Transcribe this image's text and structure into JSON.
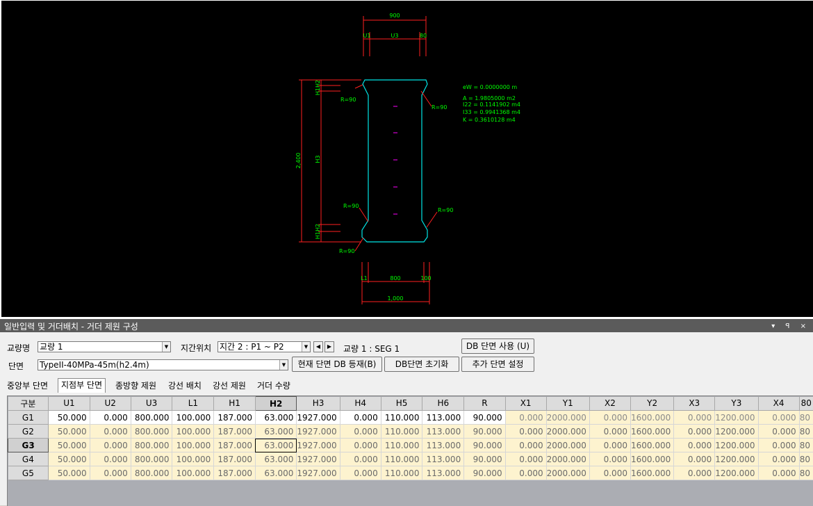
{
  "drawing": {
    "top_dims": {
      "total": "900",
      "u1": "U1",
      "u3": "U3",
      "u_right": "80"
    },
    "bottom_dims": {
      "l1": "L1",
      "mid": "800",
      "right": "100",
      "total": "1,000"
    },
    "height_total": "2,400",
    "h_labels": {
      "top": "H1H2",
      "mid": "H3",
      "bottom": "H1H2"
    },
    "radius_labels": [
      "R=90",
      "R=90",
      "R=90",
      "R=90",
      "R=90"
    ],
    "props": [
      "eW  = 0.0000000 m",
      "A   = 1.9805000 m2",
      "I22 = 0.1141902 m4",
      "I33 = 0.9941368 m4",
      "K   = 0.3610128 m4"
    ],
    "colors": {
      "outline": "#00e5e5",
      "dim": "#ff2020",
      "text": "#00ff00",
      "mark": "#ff00ff"
    }
  },
  "panel": {
    "title": "일반입력 및 거더배치 - 거더 제원 구성",
    "title_controls": "▾ ꟼ ×",
    "bridge_label": "교량명",
    "bridge_value": "교량 1",
    "span_label": "지간위치",
    "span_value": "지간 2 : P1 ~ P2",
    "seg_text": "교량 1 : SEG 1",
    "section_label": "단면",
    "section_value": "TypeII-40MPa-45m(h2.4m)",
    "buttons": {
      "db_use": "DB 단면 사용 (U)",
      "register": "현재 단면 DB 등재(B)",
      "reset": "DB단면 초기화",
      "add_section": "추가 단면 설정"
    },
    "tabs": [
      "중앙부 단면",
      "지점부 단면",
      "종방향 제원",
      "강선 배치",
      "강선 제원",
      "거더 수량"
    ],
    "active_tab": "지점부 단면"
  },
  "grid": {
    "columns": [
      "구분",
      "U1",
      "U2",
      "U3",
      "L1",
      "H1",
      "H2",
      "H3",
      "H4",
      "H5",
      "H6",
      "R",
      "X1",
      "Y1",
      "X2",
      "Y2",
      "X3",
      "Y3",
      "X4",
      "80"
    ],
    "selected_column": "H2",
    "selected_row": "G3",
    "rows": [
      {
        "name": "G1",
        "values": [
          "50.000",
          "0.000",
          "800.000",
          "100.000",
          "187.000",
          "63.000",
          "1927.000",
          "0.000",
          "110.000",
          "113.000",
          "90.000",
          "0.000",
          "2000.000",
          "0.000",
          "1600.000",
          "0.000",
          "1200.000",
          "0.000",
          "80"
        ]
      },
      {
        "name": "G2",
        "values": [
          "50.000",
          "0.000",
          "800.000",
          "100.000",
          "187.000",
          "63.000",
          "1927.000",
          "0.000",
          "110.000",
          "113.000",
          "90.000",
          "0.000",
          "2000.000",
          "0.000",
          "1600.000",
          "0.000",
          "1200.000",
          "0.000",
          "80"
        ]
      },
      {
        "name": "G3",
        "values": [
          "50.000",
          "0.000",
          "800.000",
          "100.000",
          "187.000",
          "63.000",
          "1927.000",
          "0.000",
          "110.000",
          "113.000",
          "90.000",
          "0.000",
          "2000.000",
          "0.000",
          "1600.000",
          "0.000",
          "1200.000",
          "0.000",
          "80"
        ]
      },
      {
        "name": "G4",
        "values": [
          "50.000",
          "0.000",
          "800.000",
          "100.000",
          "187.000",
          "63.000",
          "1927.000",
          "0.000",
          "110.000",
          "113.000",
          "90.000",
          "0.000",
          "2000.000",
          "0.000",
          "1600.000",
          "0.000",
          "1200.000",
          "0.000",
          "80"
        ]
      },
      {
        "name": "G5",
        "values": [
          "50.000",
          "0.000",
          "800.000",
          "100.000",
          "187.000",
          "63.000",
          "1927.000",
          "0.000",
          "110.000",
          "113.000",
          "90.000",
          "0.000",
          "2000.000",
          "0.000",
          "1600.000",
          "0.000",
          "1200.000",
          "0.000",
          "80"
        ]
      }
    ]
  }
}
